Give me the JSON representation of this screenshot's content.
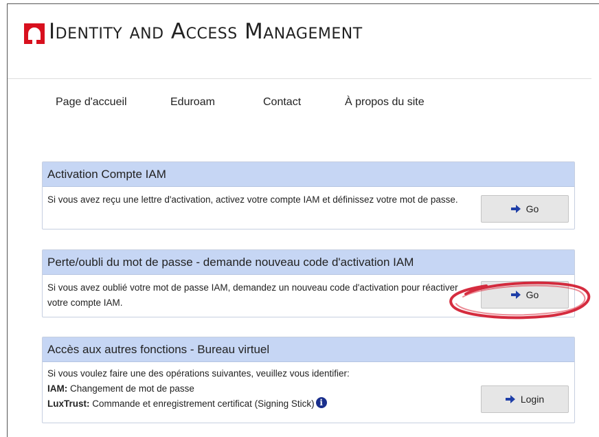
{
  "header": {
    "title": "Identity and Access Management",
    "logo": "university-logo",
    "brand_color": "#d8101e"
  },
  "nav": {
    "items": [
      {
        "label": "Page d'accueil"
      },
      {
        "label": "Eduroam"
      },
      {
        "label": "Contact"
      },
      {
        "label": "À propos du site"
      }
    ]
  },
  "panels": [
    {
      "title": "Activation Compte IAM",
      "text": "Si vous avez reçu une lettre d'activation, activez votre compte IAM et définissez votre mot de passe.",
      "button": "Go"
    },
    {
      "title": "Perte/oubli du mot de passe - demande nouveau code d'activation IAM",
      "text": "Si vous avez oublié votre mot de passe IAM, demandez un nouveau code d'activation pour réactiver votre compte IAM.",
      "button": "Go"
    },
    {
      "title": "Accès aux autres fonctions - Bureau virtuel",
      "intro": "Si vous voulez faire une des opérations suivantes, veuillez vous identifier:",
      "line1_label": "IAM:",
      "line1_text": " Changement de mot de passe",
      "line2_label": "LuxTrust:",
      "line2_text": " Commande et enregistrement certificat (Signing Stick)",
      "info_glyph": "i",
      "button": "Login"
    }
  ],
  "colors": {
    "panel_header": "#c6d6f4",
    "button_bg": "#e6e6e6",
    "arrow": "#1f3fa8",
    "annotation": "#d0152a"
  },
  "icons": {
    "button_arrow": "arrow-right-icon",
    "info": "info-icon"
  }
}
